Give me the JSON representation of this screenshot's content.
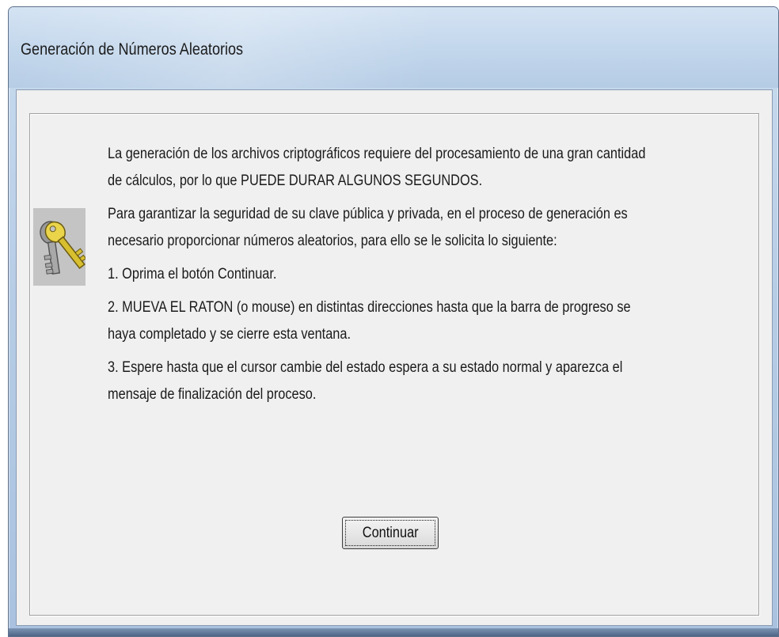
{
  "window": {
    "title": "Generación de Números Aleatorios"
  },
  "dialog": {
    "icon": "keys-icon",
    "paragraphs": [
      {
        "lines": [
          "La generación de los archivos criptográficos requiere del procesamiento de una gran cantidad",
          "de cálculos, por lo que PUEDE DURAR ALGUNOS SEGUNDOS."
        ]
      },
      {
        "lines": [
          "Para garantizar la seguridad de su clave pública y privada, en el proceso de generación es",
          "necesario proporcionar números aleatorios, para ello se le solicita lo siguiente:"
        ]
      },
      {
        "lines": [
          "1. Oprima el botón Continuar."
        ]
      },
      {
        "lines": [
          "2. MUEVA EL RATON (o mouse) en distintas direcciones hasta que la barra de progreso se",
          "haya completado y se cierre esta ventana."
        ]
      },
      {
        "lines": [
          "3. Espere hasta que el cursor cambie del estado espera a su estado normal y aparezca el",
          "mensaje de finalización del proceso."
        ]
      }
    ],
    "continue_label": "Continuar"
  }
}
